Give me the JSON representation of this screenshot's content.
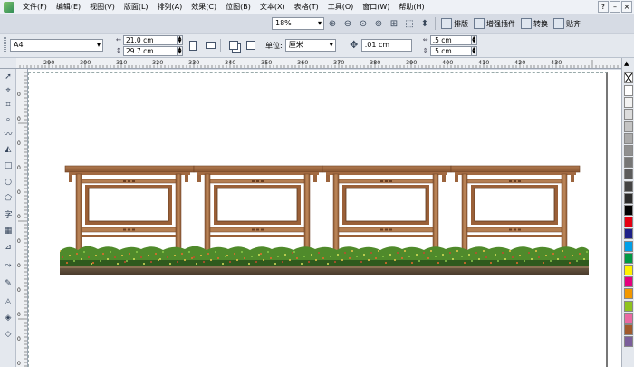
{
  "menu": {
    "items": [
      "文件(F)",
      "编辑(E)",
      "视图(V)",
      "版面(L)",
      "排列(A)",
      "效果(C)",
      "位图(B)",
      "文本(X)",
      "表格(T)",
      "工具(O)",
      "窗口(W)",
      "帮助(H)"
    ]
  },
  "toolbar": {
    "zoom": "18%",
    "buttons": [
      "排版",
      "增强插件",
      "转换",
      "贴齐"
    ]
  },
  "property_bar": {
    "paper": "A4",
    "width": "21.0 cm",
    "height": "29.7 cm",
    "unit_label": "单位:",
    "unit": "厘米",
    "nudge": ".01 cm",
    "dup_x": ".5 cm",
    "dup_y": ".5 cm"
  },
  "ruler": {
    "h_labels": [
      "290",
      "300",
      "310",
      "320",
      "330",
      "340",
      "350",
      "360",
      "370",
      "380",
      "390",
      "400",
      "410",
      "420",
      "430"
    ],
    "v_labels": [
      "0",
      "0",
      "0",
      "0",
      "0",
      "0",
      "0",
      "0",
      "0",
      "0",
      "0",
      "0"
    ]
  },
  "tools": [
    "pick-tool",
    "shape-tool",
    "crop-tool",
    "zoom-tool",
    "freehand-tool",
    "smart-fill-tool",
    "rectangle-tool",
    "ellipse-tool",
    "polygon-tool",
    "text-tool",
    "table-tool",
    "dimension-tool",
    "eyedropper-tool",
    "outline-tool",
    "fill-tool",
    "interactive-fill-tool"
  ],
  "palette": {
    "colors": [
      "#ffffff",
      "#f2f2f2",
      "#dcdcdc",
      "#c4c4c4",
      "#aaaaaa",
      "#909090",
      "#767676",
      "#5c5c5c",
      "#444444",
      "#2c2c2c",
      "#000000",
      "#e60012",
      "#1d2088",
      "#00a0e9",
      "#009944",
      "#fff100",
      "#e4007f",
      "#f39800",
      "#8fc31f",
      "#ea68a2",
      "#a05a2c",
      "#7b5e9b"
    ]
  }
}
